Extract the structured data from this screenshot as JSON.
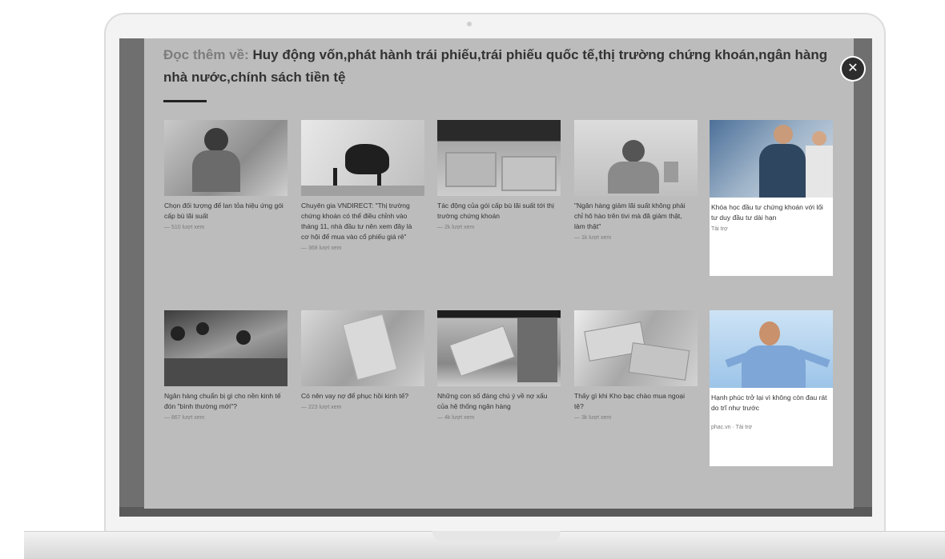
{
  "heading": {
    "prefix": "Đọc thêm về:",
    "topics": "Huy động vốn,phát hành trái phiếu,trái phiếu quốc tế,thị trường chứng khoán,ngân hàng nhà nước,chính sách tiền tệ"
  },
  "close_icon": "✕",
  "cards": [
    {
      "title": "Chọn đối tượng để lan tỏa hiệu ứng gói cấp bù lãi suất",
      "views": "— 510 lượt xem",
      "image": "woman-bank-icon"
    },
    {
      "title": "Chuyên gia VNDIRECT: \"Thị trường chứng khoán có thể điều chỉnh vào tháng 11, nhà đầu tư nên xem đây là cơ hội để mua vào cổ phiếu giá rẻ\"",
      "views": "— 368 lượt xem",
      "image": "bull-icon"
    },
    {
      "title": "Tác động của gói cấp bù lãi suất tới thị trường chứng khoán",
      "views": "— 2k lượt xem",
      "image": "money-stacks-icon"
    },
    {
      "title": "\"Ngân hàng giảm lãi suất không phải chỉ hô hào trên tivi mà đã giảm thật, làm thật\"",
      "views": "— 1k lượt xem",
      "image": "official-portrait-icon"
    },
    {
      "title": "Khóa học đầu tư chứng khoán với lối tư duy đầu tư dài hạn",
      "views": "Tài trợ",
      "image": "traders-icon",
      "ad": true
    },
    {
      "title": "Ngân hàng chuẩn bị gì cho nền kinh tế đón \"bình thường mới\"?",
      "views": "— 867 lượt xem",
      "image": "bank-crowd-icon"
    },
    {
      "title": "Có nên vay nợ để phục hồi kinh tế?",
      "views": "— 223 lượt xem",
      "image": "counting-money-icon"
    },
    {
      "title": "Những con số đáng chú ý về nợ xấu của hệ thống ngân hàng",
      "views": "— 4k lượt xem",
      "image": "cash-hands-icon"
    },
    {
      "title": "Thấy gì khi Kho bạc chào mua ngoại tệ?",
      "views": "— 3k lượt xem",
      "image": "dollar-bills-icon"
    },
    {
      "title": "Hạnh phúc trở lại vì không còn đau rát do trĩ như trước",
      "views": "phac.vn · Tài trợ",
      "image": "happy-man-icon",
      "ad": true
    }
  ]
}
